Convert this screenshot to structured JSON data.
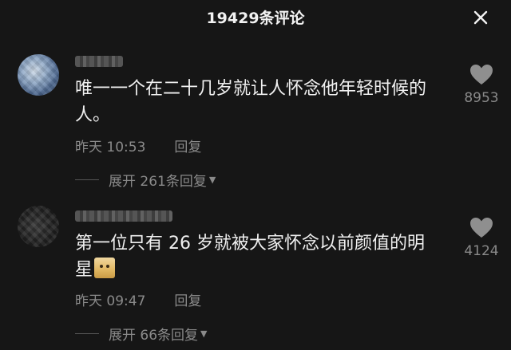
{
  "header": {
    "title": "19429条评论",
    "close_icon": "close-icon"
  },
  "comments": [
    {
      "username": "",
      "text": "唯一一个在二十几岁就让人怀念他年轻时候的人。",
      "text_line1": "唯一一个在二十几岁就让人怀念他年轻时候的",
      "text_line2": "人。",
      "time": "昨天 10:53",
      "reply_label": "回复",
      "like_count": "8953",
      "expand_label": "展开 261条回复"
    },
    {
      "username": "",
      "text_line1": "第一位只有 26 岁就被大家怀念以前颜值的明",
      "text_line2": "星",
      "time": "昨天 09:47",
      "reply_label": "回复",
      "like_count": "4124",
      "expand_label": "展开 66条回复"
    }
  ],
  "colors": {
    "background": "#161616",
    "text": "#f0f0f0",
    "muted": "#8a8a8a"
  }
}
